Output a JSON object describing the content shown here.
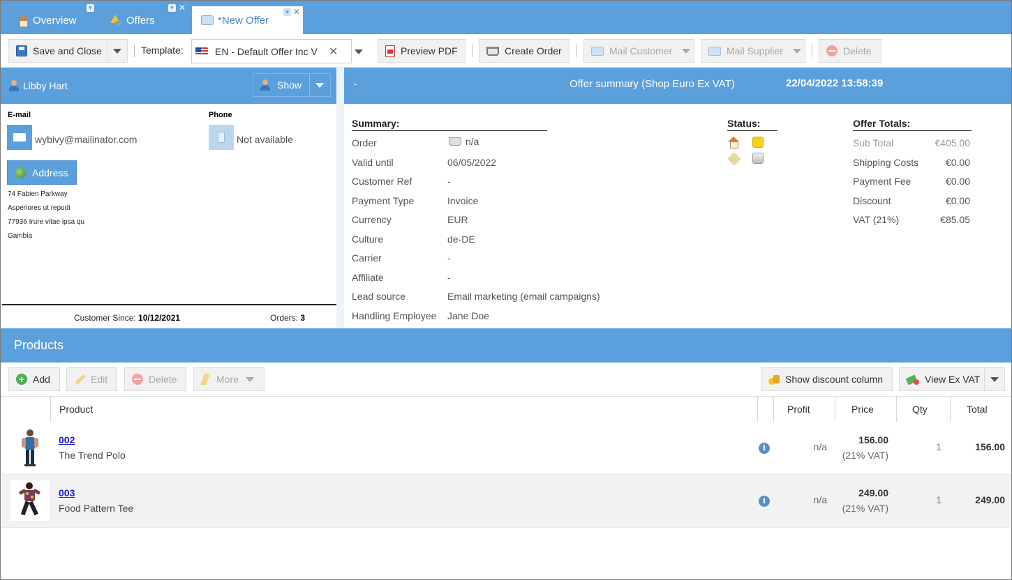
{
  "tabs": [
    {
      "label": "Overview",
      "icon": "home-icon"
    },
    {
      "label": "Offers",
      "icon": "offers-icon"
    },
    {
      "label": "*New Offer",
      "icon": "new-offer-icon"
    }
  ],
  "toolbar": {
    "save_close": "Save and Close",
    "template_label": "Template:",
    "template_value": "EN - Default Offer Inc V",
    "preview_pdf": "Preview PDF",
    "create_order": "Create Order",
    "mail_customer": "Mail Customer",
    "mail_supplier": "Mail Supplier",
    "delete": "Delete"
  },
  "customer": {
    "name": "Libby Hart",
    "show_label": "Show",
    "email_label": "E-mail",
    "email": "wybivy@mailinator.com",
    "phone_label": "Phone",
    "phone": "Not available",
    "address_label": "Address",
    "address_lines": [
      "74 Fabien Parkway",
      "Asperiores ut repudi",
      "77936 Irure vitae ipsa qu",
      "Gambia"
    ],
    "since_label": "Customer Since:",
    "since_value": "10/12/2021",
    "orders_label": "Orders:",
    "orders_value": "3"
  },
  "summary": {
    "dash": "-",
    "title": "Offer summary (Shop Euro Ex VAT)",
    "datetime": "22/04/2022 13:58:39",
    "section_title": "Summary:",
    "rows": [
      {
        "key": "Order",
        "value": "n/a"
      },
      {
        "key": "Valid until",
        "value": "06/05/2022"
      },
      {
        "key": "Customer Ref",
        "value": "-"
      },
      {
        "key": "Payment Type",
        "value": "Invoice"
      },
      {
        "key": "Currency",
        "value": "EUR"
      },
      {
        "key": "Culture",
        "value": "de-DE"
      },
      {
        "key": "Carrier",
        "value": "-"
      },
      {
        "key": "Affiliate",
        "value": "-"
      },
      {
        "key": "Lead source",
        "value": "Email marketing (email campaigns)"
      },
      {
        "key": "Handling Employee",
        "value": "Jane Doe"
      }
    ],
    "status_title": "Status:",
    "totals_title": "Offer Totals:",
    "totals": [
      {
        "key": "Sub Total",
        "value": "€405.00"
      },
      {
        "key": "Shipping Costs",
        "value": "€0.00"
      },
      {
        "key": "Payment Fee",
        "value": "€0.00"
      },
      {
        "key": "Discount",
        "value": "€0.00"
      },
      {
        "key": "VAT (21%)",
        "value": "€85.05"
      }
    ]
  },
  "products": {
    "title": "Products",
    "toolbar": {
      "add": "Add",
      "edit": "Edit",
      "delete": "Delete",
      "more": "More",
      "show_discount": "Show discount column",
      "view_ex_vat": "View Ex VAT"
    },
    "columns": {
      "product": "Product",
      "profit": "Profit",
      "price": "Price",
      "qty": "Qty",
      "total": "Total"
    },
    "rows": [
      {
        "code": "002",
        "name": "The Trend Polo",
        "profit": "n/a",
        "price": "156.00",
        "vat": "(21% VAT)",
        "qty": "1",
        "total": "156.00"
      },
      {
        "code": "003",
        "name": "Food Pattern Tee",
        "profit": "n/a",
        "price": "249.00",
        "vat": "(21% VAT)",
        "qty": "1",
        "total": "249.00"
      }
    ]
  }
}
